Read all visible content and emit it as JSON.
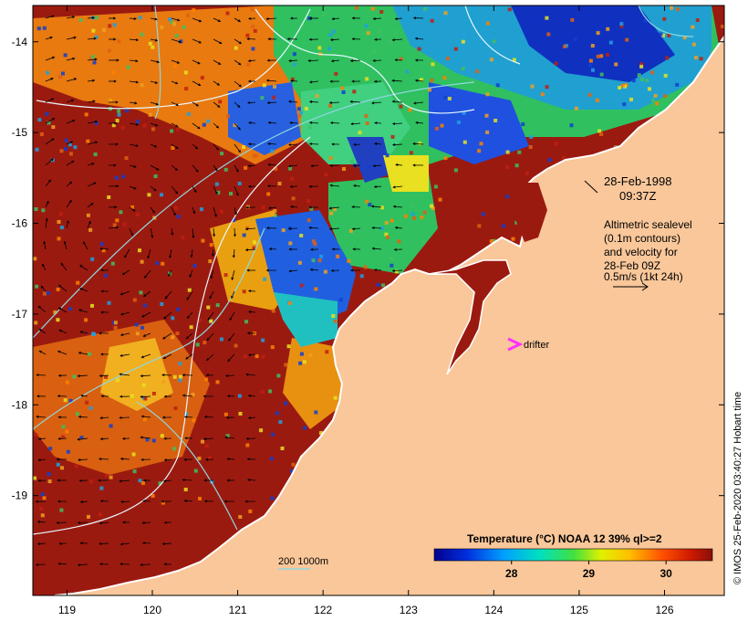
{
  "map": {
    "x_ticks": [
      "119",
      "120",
      "121",
      "122",
      "123",
      "124",
      "125",
      "126"
    ],
    "y_ticks": [
      "-14",
      "-15",
      "-16",
      "-17",
      "-18",
      "-19"
    ],
    "x_range": [
      118.6,
      126.7
    ],
    "y_range": [
      -13.6,
      -20.1
    ]
  },
  "annotations": {
    "date": "28-Feb-1998",
    "time": "09:37Z",
    "alt_line1": "Altimetric sealevel",
    "alt_line2": "(0.1m contours)",
    "alt_line3": "and velocity for",
    "alt_line4": "28-Feb 09Z",
    "alt_line5": "0.5m/s (1kt 24h)",
    "drifter_label": "drifter",
    "bathy_label": "200  1000m"
  },
  "colorbar": {
    "title": "Temperature (°C) NOAA 12 39% ql>=2",
    "ticks": [
      "28",
      "29",
      "30"
    ],
    "min": 27.0,
    "max": 30.6
  },
  "side_note": "© IMOS 25-Feb-2020 03:40:27 Hobart time",
  "colors": {
    "land": "#f9c79a",
    "warm": "#9b1a10",
    "drifter": "#ff30ff",
    "contour": "#8fd8e0"
  }
}
